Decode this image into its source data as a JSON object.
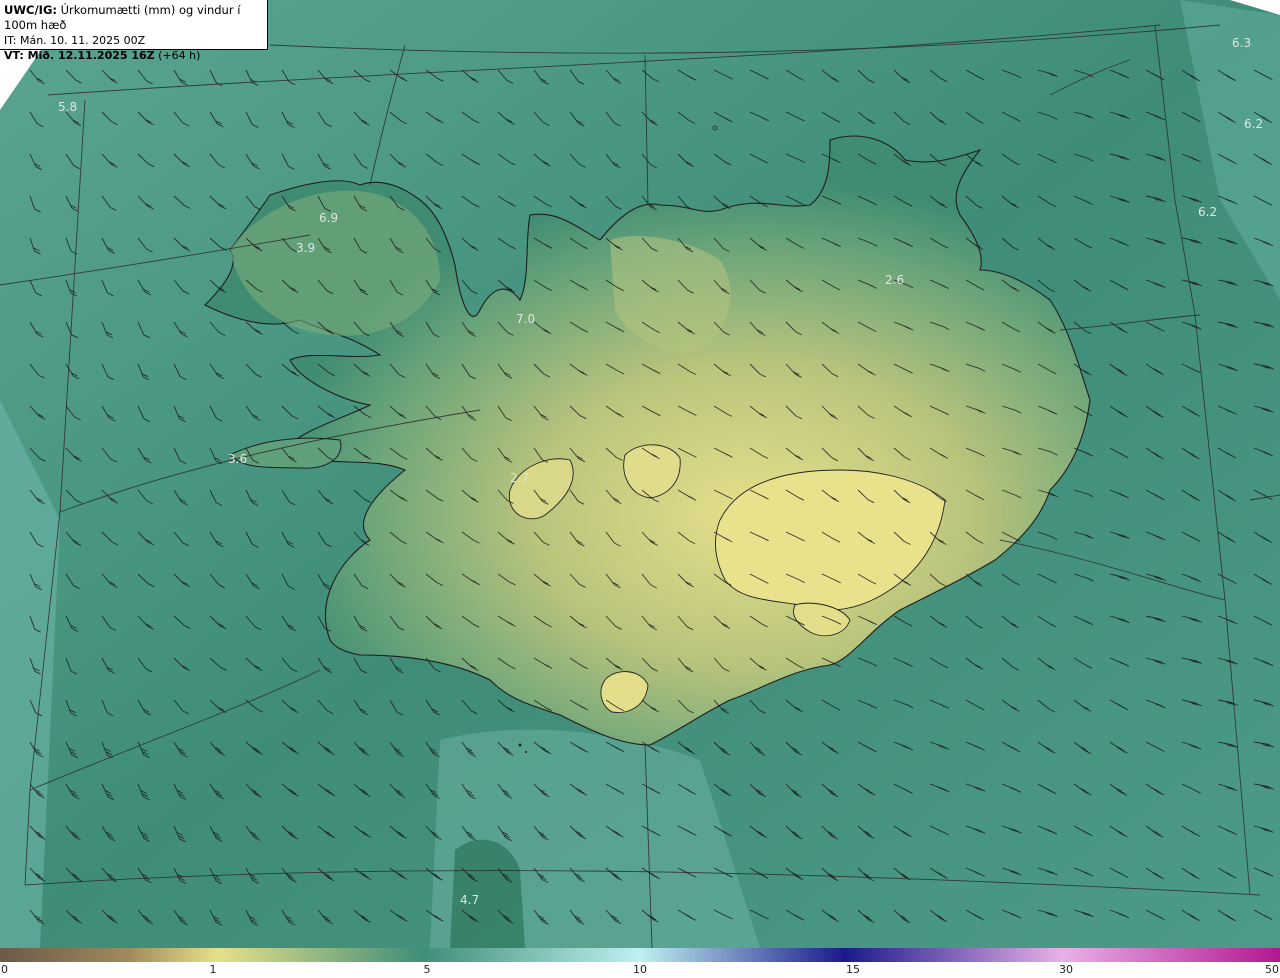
{
  "header": {
    "model": "UWC/IG:",
    "title": " Úrkomumætti (mm) og vindur í 100m hæð",
    "init_label": "IT:",
    "init_value": " Mán. 10. 11. 2025 00Z",
    "valid_label": "VT:",
    "valid_value": " Mið. 12.11.2025 16Z",
    "lead": " (+64 h)"
  },
  "map_labels": [
    {
      "text": "5.8"
    },
    {
      "text": "6.9"
    },
    {
      "text": "3.9"
    },
    {
      "text": "7.0"
    },
    {
      "text": "3.6"
    },
    {
      "text": "2.7"
    },
    {
      "text": "2.6"
    },
    {
      "text": "6.3"
    },
    {
      "text": "6.2"
    },
    {
      "text": "6.2"
    },
    {
      "text": "4.7"
    }
  ],
  "colorbar": {
    "ticks": [
      "0",
      "1",
      "5",
      "10",
      "15",
      "30",
      "50"
    ],
    "stops": [
      "#6b5a48",
      "#a08a5c",
      "#e7e08a",
      "#3f8e78",
      "#bff0f0",
      "#1a1a8a",
      "#c060c0",
      "#b01890"
    ]
  },
  "colors": {
    "ocean": "#4f9c8a",
    "land_low": "#3d8a72",
    "land_high": "#dcd98a",
    "border": "#2a2a2a"
  }
}
